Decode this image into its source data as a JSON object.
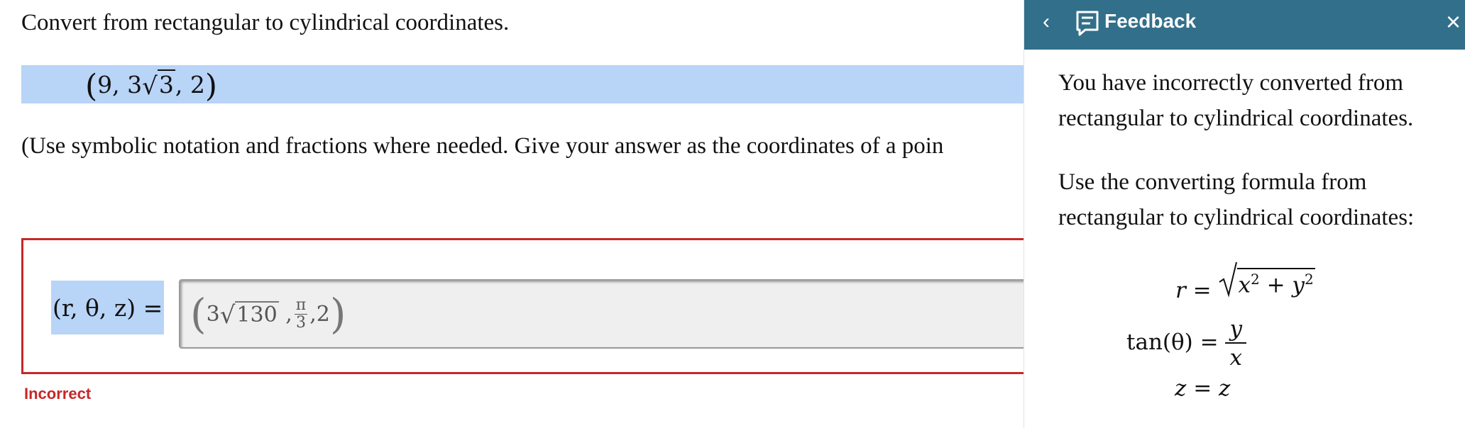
{
  "question": {
    "prompt": "Convert from rectangular to cylindrical coordinates.",
    "point": {
      "x": "9",
      "y_coef": "3",
      "y_radicand": "3",
      "z": "2"
    },
    "hint": "(Use symbolic notation and fractions where needed. Give your answer as the coordinates of a poin"
  },
  "answer": {
    "label": "(r, θ, z) =",
    "value": {
      "r_coef": "3",
      "r_radicand": "130",
      "theta_num": "π",
      "theta_den": "3",
      "z": "2"
    },
    "status": "Incorrect"
  },
  "feedback": {
    "title": "Feedback",
    "message1": "You have incorrectly converted from rectangular to cylindrical coordinates.",
    "message2": "Use the converting formula from rectangular to cylindrical coordinates:",
    "eq_r": {
      "lhs": "r",
      "x": "x",
      "y": "y",
      "exp": "2"
    },
    "eq_theta": {
      "lhs": "tan(θ)",
      "num": "y",
      "den": "x"
    },
    "eq_z": {
      "lhs": "z",
      "rhs": "z"
    }
  },
  "colors": {
    "header": "#326f8a",
    "highlight": "#b8d4f7",
    "error": "#c62828"
  },
  "icons": [
    "chevron-left-icon",
    "feedback-icon",
    "close-icon"
  ]
}
